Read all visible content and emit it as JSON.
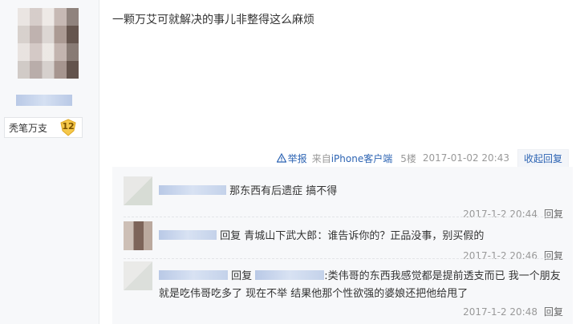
{
  "author": {
    "badge_label": "秃笔万支",
    "level": "12"
  },
  "post": {
    "content": "一颗万艾可就解决的事儿非整得这么麻烦"
  },
  "tail": {
    "report_label": "举报",
    "device_prefix": "来自",
    "device_link": "iPhone客户端",
    "floor": "5楼",
    "time": "2017-01-02 20:43",
    "collapse_label": "收起回复"
  },
  "replies": [
    {
      "text": "那东西有后遗症 搞不得",
      "time": "2017-1-2 20:44",
      "reply_label": "回复"
    },
    {
      "prefix": "回复",
      "target": "青城山下武大郎",
      "text": "：谁告诉你的？正品没事，别买假的",
      "time": "2017-1-2 20:46",
      "reply_label": "回复"
    },
    {
      "prefix": "回复",
      "text": ":类伟哥的东西我感觉都是提前透支而已 我一个朋友就是吃伟哥吃多了 现在不举 结果他那个性欲强的婆娘还把他给甩了",
      "time": "2017-1-2 20:48",
      "reply_label": "回复"
    }
  ],
  "colors": {
    "link": "#2d64b3",
    "meta": "#999999",
    "badge": "#f5c84b"
  },
  "icons": [
    "warning-triangle-icon",
    "level-badge-icon"
  ]
}
